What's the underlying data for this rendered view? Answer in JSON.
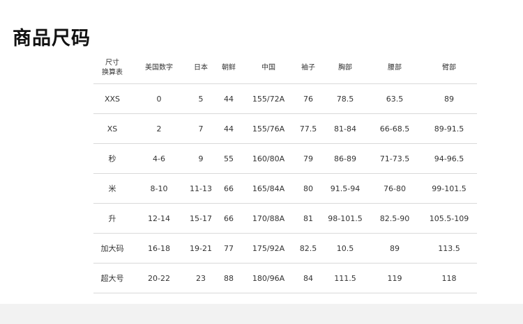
{
  "page": {
    "title": "商品尺码"
  },
  "table": {
    "headers": {
      "size": "尺寸\n换算表",
      "us": "美国数字",
      "jp": "日本",
      "kr": "朝鲜",
      "cn": "中国",
      "sleeve": "袖子",
      "chest": "胸部",
      "waist": "腰部",
      "arm": "臂部"
    },
    "rows": [
      {
        "size": "XXS",
        "us": "0",
        "jp": "5",
        "kr": "44",
        "cn": "155/72A",
        "sleeve": "76",
        "chest": "78.5",
        "waist": "63.5",
        "arm": "89"
      },
      {
        "size": "XS",
        "us": "2",
        "jp": "7",
        "kr": "44",
        "cn": "155/76A",
        "sleeve": "77.5",
        "chest": "81-84",
        "waist": "66-68.5",
        "arm": "89-91.5"
      },
      {
        "size": "秒",
        "us": "4-6",
        "jp": "9",
        "kr": "55",
        "cn": "160/80A",
        "sleeve": "79",
        "chest": "86-89",
        "waist": "71-73.5",
        "arm": "94-96.5"
      },
      {
        "size": "米",
        "us": "8-10",
        "jp": "11-13",
        "kr": "66",
        "cn": "165/84A",
        "sleeve": "80",
        "chest": "91.5-94",
        "waist": "76-80",
        "arm": "99-101.5"
      },
      {
        "size": "升",
        "us": "12-14",
        "jp": "15-17",
        "kr": "66",
        "cn": "170/88A",
        "sleeve": "81",
        "chest": "98-101.5",
        "waist": "82.5-90",
        "arm": "105.5-109"
      },
      {
        "size": "加大码",
        "us": "16-18",
        "jp": "19-21",
        "kr": "77",
        "cn": "175/92A",
        "sleeve": "82.5",
        "chest": "10.5",
        "waist": "89",
        "arm": "113.5"
      },
      {
        "size": "超大号",
        "us": "20-22",
        "jp": "23",
        "kr": "88",
        "cn": "180/96A",
        "sleeve": "84",
        "chest": "111.5",
        "waist": "119",
        "arm": "118"
      }
    ]
  }
}
